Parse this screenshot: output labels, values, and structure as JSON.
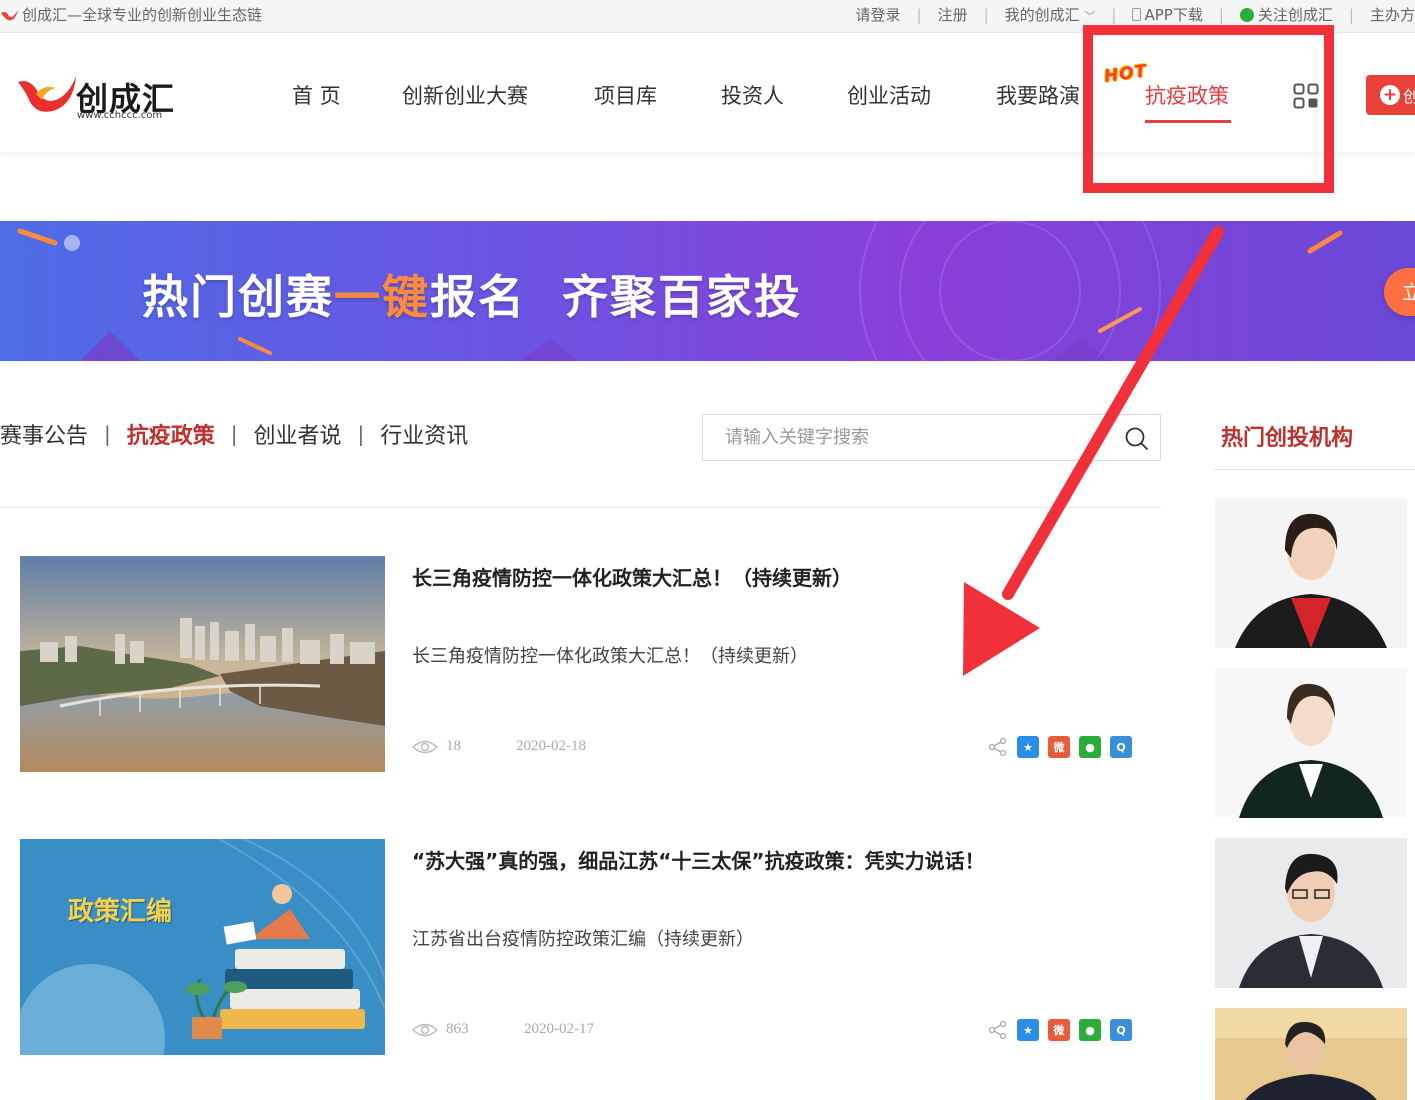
{
  "topbar": {
    "slogan": "创成汇—全球专业的创新创业生态链",
    "links": [
      "请登录",
      "注册",
      "我的创成汇",
      "APP下载",
      "关注创成汇",
      "主办方"
    ]
  },
  "header": {
    "logo_text": "创成汇",
    "logo_url": "www.cchccc.com",
    "nav": [
      "首 页",
      "创新创业大赛",
      "项目库",
      "投资人",
      "创业活动",
      "我要路演",
      "抗疫政策"
    ],
    "hot_badge": "HOT",
    "create_button_label": "创"
  },
  "banner": {
    "title_part1": "热门创赛",
    "title_accent": "一键",
    "title_part2": "报名  齐聚百家投",
    "cta_text": "立"
  },
  "tabs": {
    "items": [
      "赛事公告",
      "抗疫政策",
      "创业者说",
      "行业资讯"
    ],
    "active": "抗疫政策"
  },
  "search": {
    "placeholder": "请输入关键字搜索"
  },
  "articles": [
    {
      "title": "长三角疫情防控一体化政策大汇总！（持续更新）",
      "summary": "长三角疫情防控一体化政策大汇总！（持续更新）",
      "views": "18",
      "date": "2020-02-18"
    },
    {
      "title": "“苏大强”真的强，细品江苏“十三太保”抗疫政策：凭实力说话！",
      "summary": "江苏省出台疫情防控政策汇编（持续更新）",
      "views": "863",
      "date": "2020-02-17",
      "thumb_text": "政策汇编"
    }
  ],
  "sidebar": {
    "title": "热门创投机构"
  },
  "colors": {
    "brand_red": "#e83d3f",
    "tab_active": "#c0302d",
    "annotation_red": "#f2303a"
  }
}
